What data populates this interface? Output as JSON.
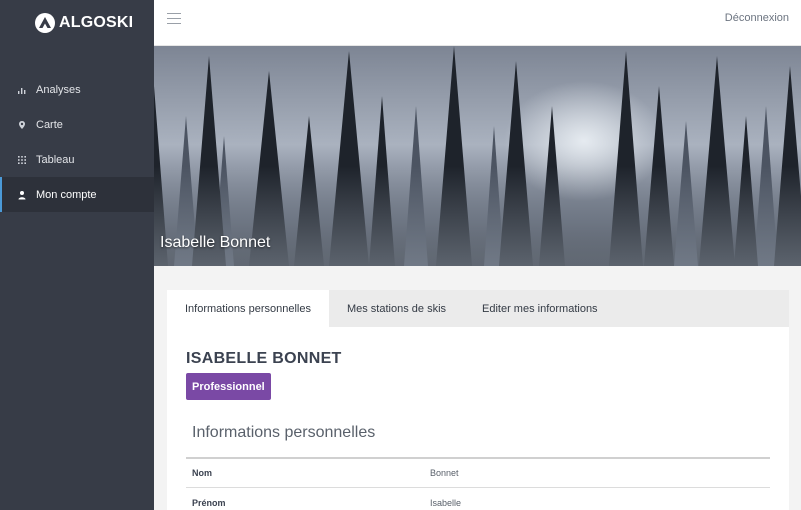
{
  "sidebar": {
    "brand": "ALGOSKI",
    "items": [
      {
        "label": "Analyses",
        "icon": "bar-chart-icon"
      },
      {
        "label": "Carte",
        "icon": "map-pin-icon"
      },
      {
        "label": "Tableau",
        "icon": "grid-icon"
      },
      {
        "label": "Mon compte",
        "icon": "user-icon",
        "active": true
      }
    ]
  },
  "topbar": {
    "logout_label": "Déconnexion"
  },
  "banner": {
    "name": "Isabelle Bonnet"
  },
  "tabs": [
    {
      "label": "Informations personnelles",
      "active": true
    },
    {
      "label": "Mes stations de skis"
    },
    {
      "label": "Editer mes informations"
    }
  ],
  "profile": {
    "full_name": "ISABELLE BONNET",
    "badge": "Professionnel",
    "section_title": "Informations personnelles",
    "fields": [
      {
        "label": "Nom",
        "value": "Bonnet"
      },
      {
        "label": "Prénom",
        "value": "Isabelle"
      }
    ]
  },
  "colors": {
    "sidebar_bg": "#373c47",
    "badge_bg": "#7a49a5",
    "active_indicator": "#4b9ad8"
  }
}
